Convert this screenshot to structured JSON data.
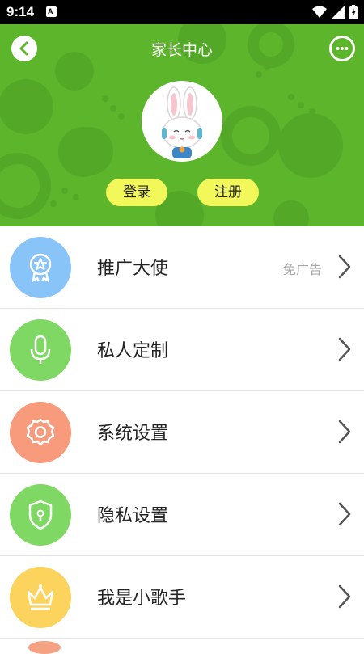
{
  "status_bar": {
    "time": "9:14",
    "notification_icon": "A"
  },
  "header": {
    "title": "家长中心",
    "login_label": "登录",
    "register_label": "注册"
  },
  "menu": [
    {
      "label": "推广大使",
      "badge": "免广告",
      "icon": "medal-icon",
      "color": "#88c4f8"
    },
    {
      "label": "私人定制",
      "badge": "",
      "icon": "microphone-icon",
      "color": "#7ed863"
    },
    {
      "label": "系统设置",
      "badge": "",
      "icon": "gear-icon",
      "color": "#f89a7c"
    },
    {
      "label": "隐私设置",
      "badge": "",
      "icon": "shield-lock-icon",
      "color": "#7ed863"
    },
    {
      "label": "我是小歌手",
      "badge": "",
      "icon": "crown-icon",
      "color": "#fbd35d"
    }
  ]
}
